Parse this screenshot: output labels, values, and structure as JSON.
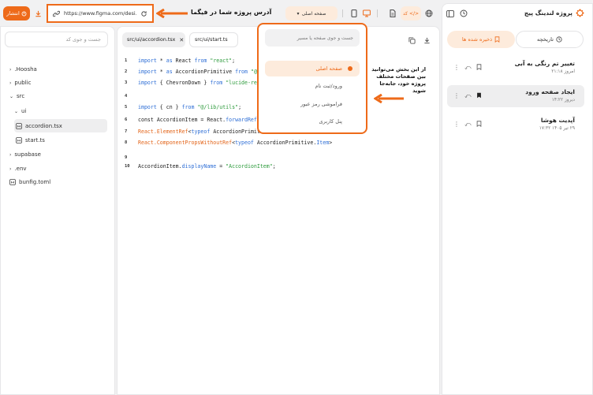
{
  "topbar": {
    "publish_label": "انتشار",
    "url_text": "https://www.figma.com/desi...",
    "page_selector_label": "صفحه اصلی",
    "code_label": "کد"
  },
  "annotations": {
    "url_note": "آدرس پروژه شما در فیگما",
    "pages_note": [
      "از این بخش می‌توانید",
      "بین صفحات مختلف",
      "پروژه خود، جابه‌جا شوید"
    ]
  },
  "file_panel": {
    "search_placeholder": "جست و جوی کد",
    "tree": [
      {
        "label": ".Hoosha",
        "type": "folder",
        "expanded": false
      },
      {
        "label": "public",
        "type": "folder",
        "expanded": false
      },
      {
        "label": "src",
        "type": "folder",
        "expanded": true
      },
      {
        "label": "ui",
        "type": "folder",
        "expanded": true
      },
      {
        "label": "accordion.tsx",
        "type": "file",
        "selected": true
      },
      {
        "label": "start.ts",
        "type": "file"
      },
      {
        "label": "supabase",
        "type": "folder",
        "expanded": false
      },
      {
        "label": ".env",
        "type": "folder",
        "expanded": false
      },
      {
        "label": "bunfig.toml",
        "type": "file"
      }
    ]
  },
  "editor": {
    "tabs": [
      {
        "label": "src/ui/accordion.tsx",
        "active": true
      },
      {
        "label": "src/ui/start.ts",
        "active": false
      }
    ],
    "lines": [
      {
        "n": "1",
        "tokens": [
          [
            "kw",
            "import"
          ],
          [
            "pl",
            " * "
          ],
          [
            "kw",
            "as"
          ],
          [
            "pl",
            " React "
          ],
          [
            "kw",
            "from"
          ],
          [
            "str",
            " \"react\""
          ],
          [
            "pl",
            ";"
          ]
        ]
      },
      {
        "n": "2",
        "tokens": [
          [
            "kw",
            "import"
          ],
          [
            "pl",
            " * "
          ],
          [
            "kw",
            "as"
          ],
          [
            "pl",
            " AccordionPrimitive "
          ],
          [
            "kw",
            "from"
          ],
          [
            "str",
            " \"@radix-ui/react-"
          ]
        ]
      },
      {
        "n": "3",
        "tokens": [
          [
            "kw",
            "import"
          ],
          [
            "pl",
            " { ChevronDown } "
          ],
          [
            "kw",
            "from"
          ],
          [
            "str",
            " \"lucide-react\""
          ],
          [
            "pl",
            ";"
          ]
        ]
      },
      {
        "n": "4",
        "tokens": []
      },
      {
        "n": "5",
        "tokens": [
          [
            "kw",
            "import"
          ],
          [
            "pl",
            " { cn } "
          ],
          [
            "kw",
            "from"
          ],
          [
            "str",
            " \"@/lib/utils\""
          ],
          [
            "pl",
            ";"
          ]
        ]
      },
      {
        "n": "6",
        "tokens": [
          [
            "pl",
            "const AccordionItem = React."
          ],
          [
            "kw",
            "forwardRef"
          ],
          [
            "pl",
            "<"
          ]
        ]
      },
      {
        "n": "7",
        "tokens": [
          [
            "fn",
            "React.ElementRef"
          ],
          [
            "pl",
            "<"
          ],
          [
            "kw",
            "typeof"
          ],
          [
            "pl",
            " AccordionPrimitive."
          ],
          [
            "kw",
            "Item"
          ],
          [
            "pl",
            ">,"
          ]
        ]
      },
      {
        "n": "8",
        "tokens": [
          [
            "fn",
            "React.ComponentPropsWithoutRef"
          ],
          [
            "pl",
            "<"
          ],
          [
            "kw",
            "typeof"
          ],
          [
            "pl",
            " AccordionPrimitive."
          ],
          [
            "kw",
            "Item"
          ],
          [
            "pl",
            ">"
          ]
        ]
      },
      {
        "n": "9",
        "tokens": []
      },
      {
        "n": "10",
        "tokens": [
          [
            "pl",
            "AccordionItem."
          ],
          [
            "kw",
            "displayName"
          ],
          [
            "pl",
            " = "
          ],
          [
            "str",
            "\"AccordionItem\""
          ],
          [
            "pl",
            ";"
          ]
        ]
      }
    ]
  },
  "page_dropdown": {
    "search_placeholder": "جست و جوی صفحه یا مسیر",
    "items": [
      {
        "label": "صفحه اصلی",
        "active": true
      },
      {
        "label": "ورود/ثبت نام",
        "active": false
      },
      {
        "label": "فراموشی رمز عبور",
        "active": false
      },
      {
        "label": "پنل کاربری",
        "active": false
      }
    ]
  },
  "right_panel": {
    "project_title": "پروژه لندینگ پیج",
    "tab_history": "تاریخچه",
    "tab_saved": "ذخیره شده ها",
    "versions": [
      {
        "title": "تغییر تم رنگی به آبی",
        "date": "امروز ۲۱:۱۸",
        "bookmarked": false
      },
      {
        "title": "ایجاد صفحه ورود",
        "date": "دیروز ۱۴:۲۲",
        "bookmarked": true
      },
      {
        "title": "آپدیت هوشا",
        "date": "۲۹ تیر ۱۴۰۵ ۱۷:۳۲",
        "bookmarked": false
      }
    ]
  },
  "colors": {
    "accent": "#ee6a19",
    "accent_light": "#fdebdc",
    "selected_row": "#eeeeef"
  }
}
